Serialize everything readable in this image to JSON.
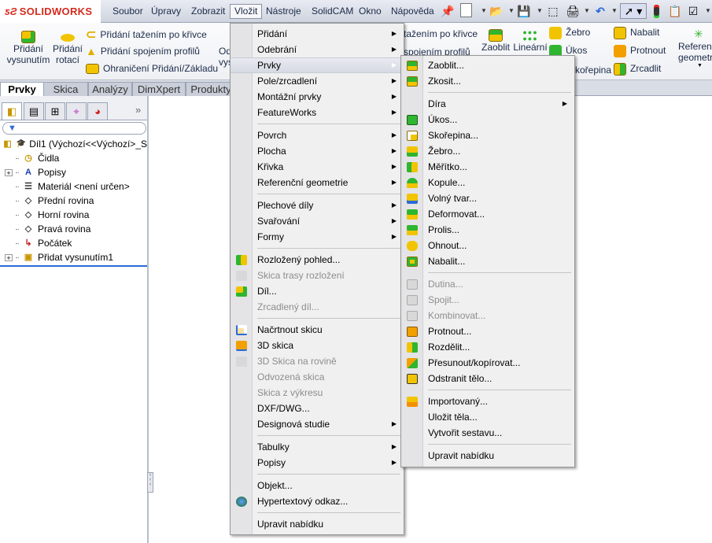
{
  "app": {
    "logo_text": "SOLIDWORKS"
  },
  "menubar": [
    {
      "label": "Soubor"
    },
    {
      "label": "Úpravy"
    },
    {
      "label": "Zobrazit"
    },
    {
      "label": "Vložit",
      "active": true
    },
    {
      "label": "Nástroje"
    },
    {
      "label": "SolidCAM"
    },
    {
      "label": "Okno"
    },
    {
      "label": "Nápověda"
    }
  ],
  "toolbar": {
    "icons": [
      "pin-icon",
      "new-document-icon",
      "open-icon",
      "save-icon",
      "3d-view-icon",
      "print-icon",
      "undo-icon",
      "select-icon",
      "rebuild-icon",
      "options-icon",
      "checklist-icon"
    ]
  },
  "ribbon": {
    "extrude_boss": [
      "Přidání",
      "vysunutím"
    ],
    "revolve_boss": [
      "Přidání",
      "rotací"
    ],
    "sweep": "Přidání tažením po křivce",
    "loft": "Přidání spojením profilů",
    "boundary": "Ohraničení Přidání/Základu",
    "cut_partial": [
      "Od",
      "vys"
    ],
    "cut_sweep_partial": "tažením po křivce",
    "cut_loft_partial": "spojením profilů",
    "fillet": "Zaoblit",
    "linear": "Lineární",
    "rib": "Žebro",
    "draft": "Úkos",
    "shell_partial": "kořepina",
    "wrap": "Nabalit",
    "intersect": "Protnout",
    "mirror": "Zrcadlit",
    "refgeom": [
      "Referenční",
      "geometrie"
    ]
  },
  "tabs": [
    {
      "label": "Prvky",
      "active": true
    },
    {
      "label": "Skica"
    },
    {
      "label": "Analýzy"
    },
    {
      "label": "DimXpert"
    },
    {
      "label": "Produkty"
    }
  ],
  "panel": {
    "tab_icons": [
      "feature-manager-icon",
      "property-manager-icon",
      "configuration-manager-icon",
      "dimxpert-manager-icon",
      "display-manager-icon"
    ],
    "more": "»",
    "tree": [
      {
        "label": "Díl1  (Výchozí<<Výchozí>_S",
        "icon": "part-icon",
        "root": true
      },
      {
        "label": "Čidla",
        "icon": "sensors-folder-icon"
      },
      {
        "label": "Popisy",
        "icon": "annotations-folder-icon",
        "expand": true
      },
      {
        "label": "Materiál <není určen>",
        "icon": "material-icon"
      },
      {
        "label": "Přední rovina",
        "icon": "plane-icon"
      },
      {
        "label": "Horní rovina",
        "icon": "plane-icon"
      },
      {
        "label": "Pravá rovina",
        "icon": "plane-icon"
      },
      {
        "label": "Počátek",
        "icon": "origin-icon"
      },
      {
        "label": "Přidat vysunutím1",
        "icon": "extrude-feature-icon",
        "expand": true
      }
    ]
  },
  "insert_menu": [
    {
      "label": "Přidání",
      "arrow": true
    },
    {
      "label": "Odebrání",
      "arrow": true
    },
    {
      "label": "Prvky",
      "arrow": true,
      "highlight": true
    },
    {
      "label": "Pole/zrcadlení",
      "arrow": true
    },
    {
      "label": "Montážní prvky",
      "arrow": true
    },
    {
      "label": "FeatureWorks",
      "arrow": true
    },
    {
      "sep": true
    },
    {
      "label": "Povrch",
      "arrow": true
    },
    {
      "label": "Plocha",
      "arrow": true
    },
    {
      "label": "Křivka",
      "arrow": true
    },
    {
      "label": "Referenční geometrie",
      "arrow": true
    },
    {
      "sep": true
    },
    {
      "label": "Plechové díly",
      "arrow": true
    },
    {
      "label": "Svařování",
      "arrow": true
    },
    {
      "label": "Formy",
      "arrow": true
    },
    {
      "sep": true
    },
    {
      "label": "Rozložený pohled...",
      "icon": "exploded-view-icon"
    },
    {
      "label": "Skica trasy rozložení",
      "icon": "explode-line-icon",
      "disabled": true
    },
    {
      "label": "Díl...",
      "icon": "insert-part-icon"
    },
    {
      "label": "Zrcadlený díl...",
      "disabled": true
    },
    {
      "sep": true
    },
    {
      "label": "Načrtnout skicu",
      "icon": "sketch-icon"
    },
    {
      "label": "3D skica",
      "icon": "3d-sketch-icon"
    },
    {
      "label": "3D Skica na rovině",
      "icon": "3d-sketch-plane-icon",
      "disabled": true
    },
    {
      "label": "Odvozená skica",
      "disabled": true
    },
    {
      "label": "Skica z výkresu",
      "disabled": true
    },
    {
      "label": "DXF/DWG..."
    },
    {
      "label": "Designová studie",
      "arrow": true
    },
    {
      "sep": true
    },
    {
      "label": "Tabulky",
      "arrow": true
    },
    {
      "label": "Popisy",
      "arrow": true
    },
    {
      "sep": true
    },
    {
      "label": "Objekt..."
    },
    {
      "label": "Hypertextový odkaz...",
      "icon": "hyperlink-icon"
    },
    {
      "sep": true
    },
    {
      "label": "Upravit nabídku"
    }
  ],
  "features_menu": [
    {
      "label": "Zaoblit...",
      "icon": "fillet-icon"
    },
    {
      "label": "Zkosit...",
      "icon": "chamfer-icon"
    },
    {
      "sep": true
    },
    {
      "label": "Díra",
      "arrow": true
    },
    {
      "label": "Úkos...",
      "icon": "draft-icon"
    },
    {
      "label": "Skořepina...",
      "icon": "shell-icon"
    },
    {
      "label": "Žebro...",
      "icon": "rib-icon"
    },
    {
      "label": "Měřítko...",
      "icon": "scale-icon"
    },
    {
      "label": "Kopule...",
      "icon": "dome-icon"
    },
    {
      "label": "Volný tvar...",
      "icon": "freeform-icon"
    },
    {
      "label": "Deformovat...",
      "icon": "deform-icon"
    },
    {
      "label": "Prolis...",
      "icon": "indent-icon"
    },
    {
      "label": "Ohnout...",
      "icon": "flex-icon"
    },
    {
      "label": "Nabalit...",
      "icon": "wrap-icon"
    },
    {
      "sep": true
    },
    {
      "label": "Dutina...",
      "icon": "cavity-icon",
      "disabled": true
    },
    {
      "label": "Spojit...",
      "icon": "join-icon",
      "disabled": true
    },
    {
      "label": "Kombinovat...",
      "icon": "combine-icon",
      "disabled": true
    },
    {
      "label": "Protnout...",
      "icon": "intersect-icon"
    },
    {
      "label": "Rozdělit...",
      "icon": "split-icon"
    },
    {
      "label": "Přesunout/kopírovat...",
      "icon": "move-copy-icon"
    },
    {
      "label": "Odstranit tělo...",
      "icon": "delete-body-icon"
    },
    {
      "sep": true
    },
    {
      "label": "Importovaný...",
      "icon": "imported-icon"
    },
    {
      "label": "Uložit těla..."
    },
    {
      "label": "Vytvořit sestavu..."
    },
    {
      "sep": true
    },
    {
      "label": "Upravit nabídku"
    }
  ],
  "colors": {
    "brand": "#d52b1e",
    "feature_yellow": "#f2c400",
    "feature_green": "#2fb52f"
  }
}
